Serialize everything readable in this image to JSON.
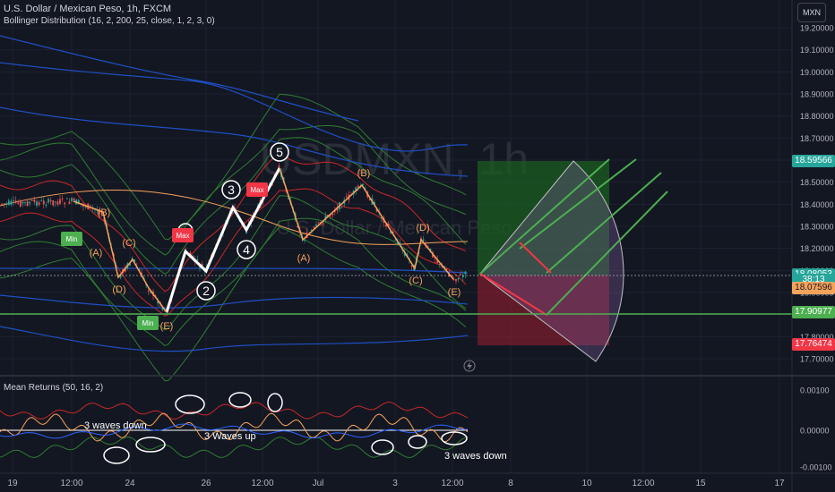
{
  "header": {
    "symbol": "U.S. Dollar / Mexican Peso, 1h, FXCM",
    "indicator": "Bollinger Distribution (16, 2, 200, 25, close, 1, 2, 3, 0)",
    "watermark_symbol": "USDMXN, 1h",
    "watermark_name": "U.S. Dollar / Mexican Peso",
    "currency_button": "MXN"
  },
  "price_axis": {
    "ticks": [
      "19.20000",
      "19.10000",
      "19.00000",
      "18.90000",
      "18.80000",
      "18.70000",
      "18.60000",
      "18.50000",
      "18.40000",
      "18.30000",
      "18.20000",
      "18.10000",
      "18.00000",
      "17.90000",
      "17.80000",
      "17.70000"
    ],
    "tags": [
      {
        "text": "18.59566",
        "value": 18.59566,
        "color": "#26a69a",
        "fg": "#ffffff"
      },
      {
        "text": "18.08053",
        "value": 18.08053,
        "color": "#26a69a",
        "fg": "#ffffff"
      },
      {
        "text": "38:13",
        "value": 18.055,
        "color": "#26a69a",
        "fg": "#ffffff"
      },
      {
        "text": "18.07596",
        "value": 18.02,
        "color": "#f7a35c",
        "fg": "#131722"
      },
      {
        "text": "17.90977",
        "value": 17.90977,
        "color": "#4caf50",
        "fg": "#ffffff"
      },
      {
        "text": "17.76474",
        "value": 17.76474,
        "color": "#f23645",
        "fg": "#ffffff"
      }
    ]
  },
  "subpane": {
    "title": "Mean Returns (50, 16, 2)",
    "ticks": [
      "0.00100",
      "0.00000",
      "-0.00100"
    ]
  },
  "time_axis": {
    "labels": [
      "19",
      "12:00",
      "24",
      "26",
      "12:00",
      "Jul",
      "3",
      "12:00",
      "8",
      "10",
      "12:00",
      "15",
      "17"
    ]
  },
  "annotations": {
    "waves": [
      "5",
      "3",
      "4",
      "2"
    ],
    "corrective": [
      "(B)",
      "(A)",
      "(C)",
      "(D)",
      "(E)",
      "(B)",
      "(A)",
      "(D)",
      "(C)",
      "(E)"
    ],
    "badges": [
      "Min",
      "Max",
      "Max",
      "Max",
      "Min"
    ],
    "sub_notes": [
      "3 waves down",
      "3 Waves up",
      "3 waves down"
    ]
  },
  "chart_data": [
    {
      "type": "line",
      "title": "U.S. Dollar / Mexican Peso, 1h, FXCM",
      "ylim": [
        17.64,
        19.26
      ],
      "series": [
        {
          "values_label": "price (approx.)",
          "x": [
            "19",
            "12:00",
            "24",
            "26",
            "12:00",
            "Jul",
            "3",
            "12:00"
          ],
          "values": [
            18.42,
            18.45,
            18.23,
            18.2,
            18.4,
            18.36,
            18.25,
            18.08
          ]
        }
      ],
      "levels": {
        "take_profit": 18.59566,
        "last": 18.08053,
        "support": 17.90977,
        "stop": 17.76474
      }
    },
    {
      "type": "line",
      "title": "Mean Returns (50, 16, 2)",
      "ylim": [
        -0.0011,
        0.0011
      ],
      "y_ticks": [
        0.001,
        0,
        -0.001
      ]
    }
  ]
}
